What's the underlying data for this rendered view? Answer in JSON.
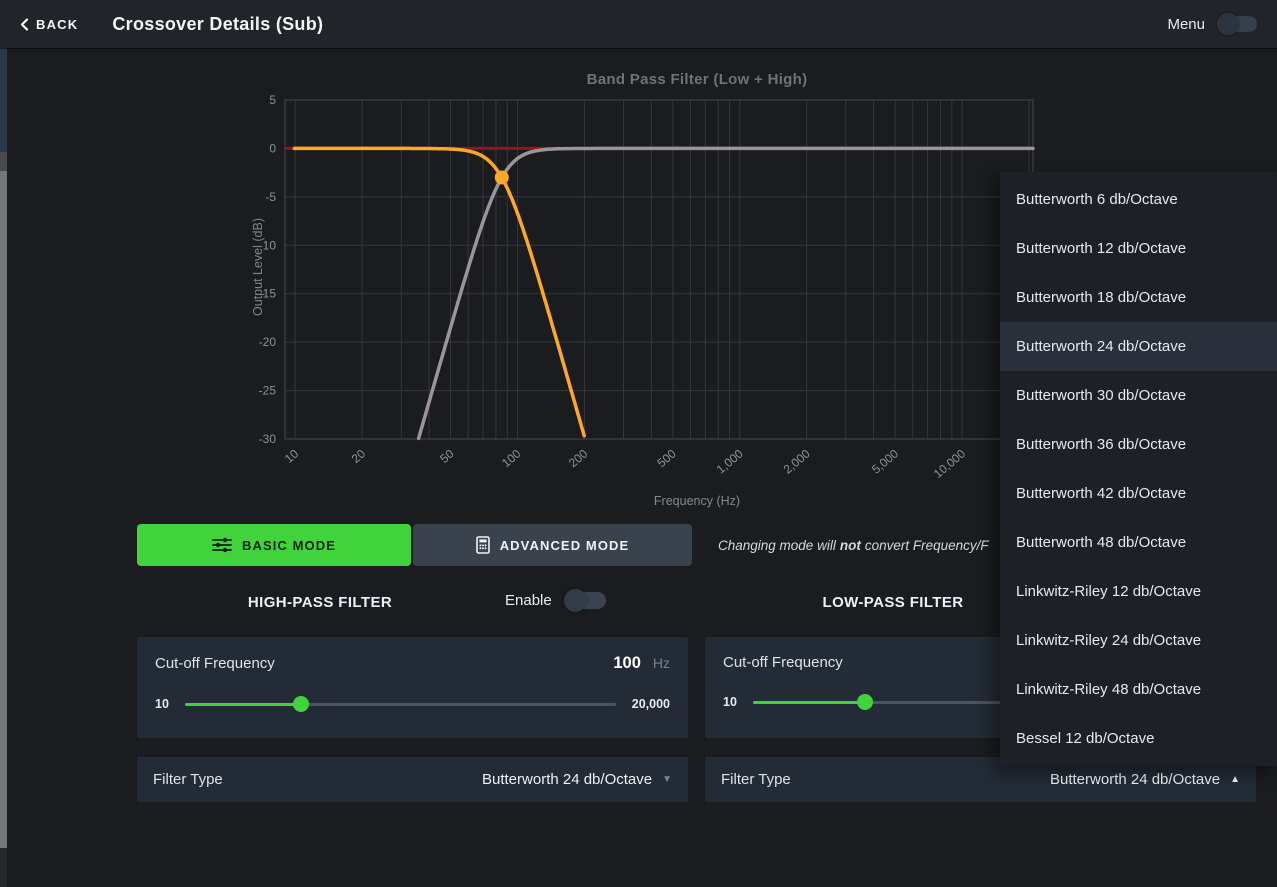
{
  "topbar": {
    "back_label": "BACK",
    "title": "Crossover Details (Sub)",
    "menu_label": "Menu",
    "menu_toggle_on": false
  },
  "chart_data": {
    "type": "line",
    "title": "Band Pass Filter (Low + High)",
    "xlabel": "Frequency (Hz)",
    "ylabel": "Output Level (dB)",
    "x_scale": "log",
    "xlim": [
      9,
      20850
    ],
    "ylim": [
      -30,
      5
    ],
    "x_ticks": [
      10,
      20,
      50,
      100,
      200,
      500,
      1000,
      2000,
      5000,
      10000
    ],
    "x_tick_labels": [
      "10",
      "20",
      "50",
      "100",
      "200",
      "500",
      "1,000",
      "2,000",
      "5,000",
      "10,000"
    ],
    "y_ticks": [
      5,
      0,
      -5,
      -10,
      -15,
      -20,
      -25,
      -30
    ],
    "grid": true,
    "grid_color": "#35373a",
    "border_color": "#47494d",
    "tick_color": "#8f9296",
    "legend": "none",
    "series": [
      {
        "name": "combined-band-pass",
        "kind": "hline",
        "level_db": 0,
        "color": "#911818"
      },
      {
        "name": "high-pass-response",
        "kind": "highpass",
        "cutoff_hz": 85,
        "order": 4,
        "slope_db_per_octave": 24,
        "color": "#9b9597"
      },
      {
        "name": "low-pass-response",
        "kind": "lowpass",
        "cutoff_hz": 85,
        "order": 4,
        "slope_db_per_octave": 24,
        "color": "#ffa726"
      }
    ],
    "crossover_marker": {
      "freq_hz": 85,
      "level_db": -3,
      "color": "#ffa726"
    }
  },
  "modes": {
    "basic_label": "BASIC MODE",
    "advanced_label": "ADVANCED MODE",
    "active": "basic"
  },
  "note": {
    "pre": "Changing mode will",
    "bold": "not",
    "post": "convert Frequency/F"
  },
  "filters": {
    "high_pass": {
      "section_label": "HIGH-PASS FILTER",
      "enable_label": "Enable",
      "enabled": false,
      "cutoff": {
        "label": "Cut-off Frequency",
        "value": "100",
        "unit": "Hz",
        "min_label": "10",
        "max_label": "20,000",
        "position_pct": 27
      },
      "filter_type": {
        "label": "Filter Type",
        "value": "Butterworth 24 db/Octave"
      }
    },
    "low_pass": {
      "section_label": "LOW-PASS FILTER",
      "cutoff": {
        "label": "Cut-off Frequency",
        "min_label": "10",
        "position_pct": 24
      },
      "filter_type": {
        "label": "Filter Type",
        "value": "Butterworth 24 db/Octave"
      }
    }
  },
  "dropdown": {
    "items": [
      "Butterworth 6 db/Octave",
      "Butterworth 12 db/Octave",
      "Butterworth 18 db/Octave",
      "Butterworth 24 db/Octave",
      "Butterworth 30 db/Octave",
      "Butterworth 36 db/Octave",
      "Butterworth 42 db/Octave",
      "Butterworth 48 db/Octave",
      "Linkwitz-Riley 12 db/Octave",
      "Linkwitz-Riley 24 db/Octave",
      "Linkwitz-Riley 48 db/Octave",
      "Bessel 12 db/Octave"
    ],
    "selected_index": 3
  },
  "icons": {
    "chevron_down": "▼",
    "chevron_up": "▲"
  },
  "colors": {
    "accent_green": "#41d33c",
    "orange": "#ffa726",
    "curve_gray": "#9b9597",
    "combined_red": "#911818",
    "panel": "#232b36",
    "dropdown_highlight": "#29303c"
  }
}
